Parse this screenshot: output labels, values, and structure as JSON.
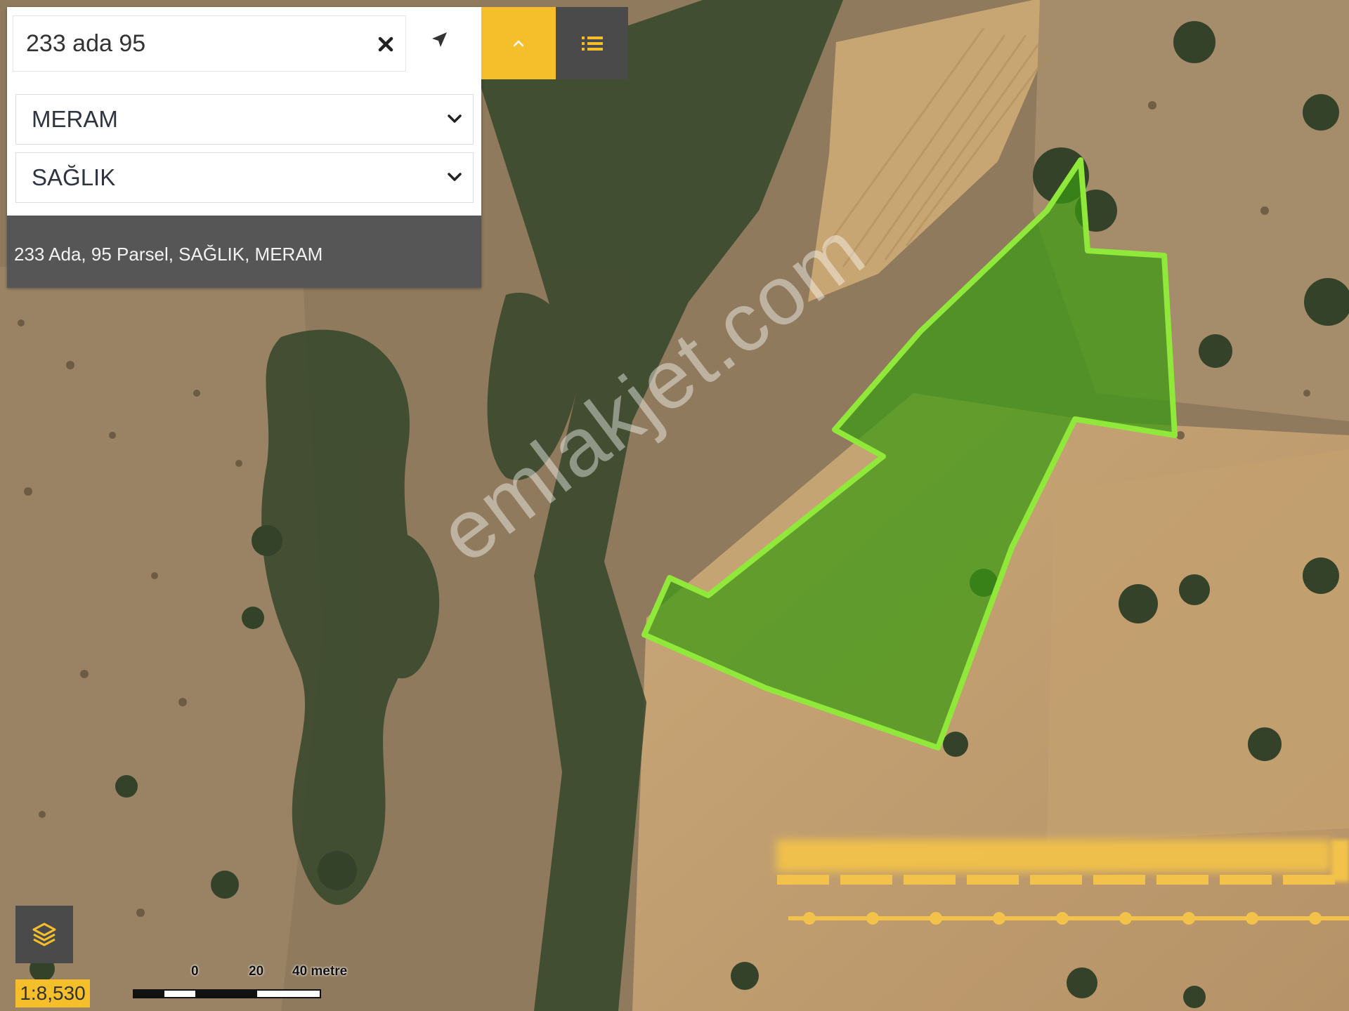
{
  "search": {
    "value": "233 ada 95",
    "clear_icon": "close-icon",
    "locate_icon": "navigation-arrow-icon"
  },
  "district_select": {
    "value": "MERAM",
    "icon": "chevron-down-icon"
  },
  "neighborhood_select": {
    "value": "SAĞLIK",
    "icon": "chevron-down-icon"
  },
  "result": {
    "text": "233 Ada, 95 Parsel, SAĞLIK, MERAM"
  },
  "toolbar": {
    "collapse_icon": "chevron-up-icon",
    "list_icon": "list-icon"
  },
  "layers": {
    "icon": "layers-icon"
  },
  "scale": {
    "ratio": "1:8,530",
    "bar_labels": [
      "0",
      "20",
      "40 metre"
    ]
  },
  "watermark": "emlakjet.com",
  "colors": {
    "accent": "#f5be2b",
    "dark_button": "#4a4a4a",
    "parcel_fill": "#3a9a12",
    "parcel_stroke": "#8fe83a"
  }
}
